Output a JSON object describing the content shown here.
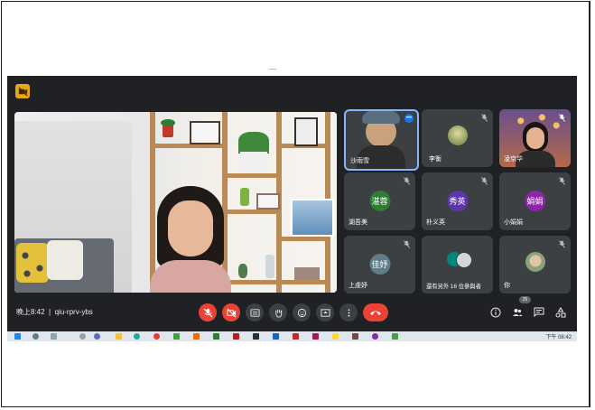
{
  "meeting": {
    "clock": "晚上8:42",
    "code": "qiu-rprv-ybs",
    "participant_count": "25",
    "colors": {
      "background": "#202124",
      "tile": "#3c4043",
      "danger": "#ea4335",
      "accent_badge": "#e6a817",
      "active_border": "#8ab4f8"
    }
  },
  "tiles": [
    {
      "name": "沙雨雪",
      "type": "video"
    },
    {
      "name": "李衡",
      "type": "photo"
    },
    {
      "name": "凌京华",
      "type": "video"
    },
    {
      "name": "湖吾美",
      "type": "avatar",
      "avatar_text": "湛蓉",
      "avatar_color": "#2e7d32"
    },
    {
      "name": "朴义英",
      "type": "avatar",
      "avatar_text": "秀英",
      "avatar_color": "#5e35b1"
    },
    {
      "name": "小娟娟",
      "type": "avatar",
      "avatar_text": "娟娟",
      "avatar_color": "#8e24aa"
    },
    {
      "name": "上虔妤",
      "type": "avatar",
      "avatar_text": "佳妤",
      "avatar_color": "#607d8b"
    },
    {
      "name": "還有另外 16 位參與者",
      "type": "group"
    },
    {
      "name": "你",
      "type": "photo"
    }
  ],
  "controls": [
    {
      "name": "mic-off",
      "icon": "mic-off-icon"
    },
    {
      "name": "camera-off",
      "icon": "camera-off-icon"
    },
    {
      "name": "captions",
      "icon": "captions-icon"
    },
    {
      "name": "raise-hand",
      "icon": "hand-icon"
    },
    {
      "name": "reactions",
      "icon": "emoji-icon"
    },
    {
      "name": "present",
      "icon": "present-icon"
    },
    {
      "name": "more",
      "icon": "more-vert-icon"
    },
    {
      "name": "leave-call",
      "icon": "call-end-icon"
    }
  ],
  "right_controls": [
    {
      "name": "info",
      "icon": "info-icon"
    },
    {
      "name": "people",
      "icon": "people-icon"
    },
    {
      "name": "chat",
      "icon": "chat-icon"
    },
    {
      "name": "activities",
      "icon": "shapes-icon"
    }
  ],
  "taskbar": {
    "time": "下午 08:42"
  }
}
